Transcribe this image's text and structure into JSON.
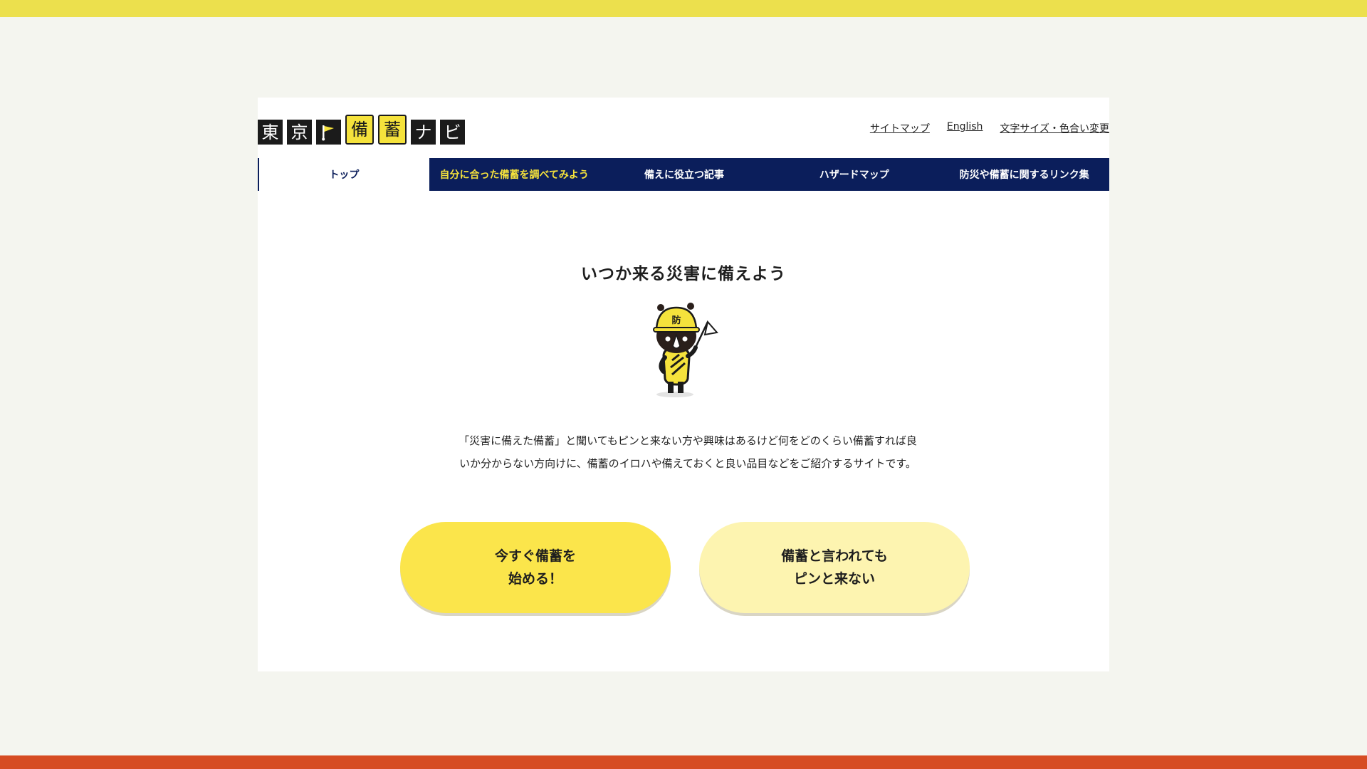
{
  "colors": {
    "top_stripe": "#ece04d",
    "bottom_stripe": "#d64c23",
    "background": "#f4f5ef",
    "nav_background": "#0b1e5b",
    "nav_highlight_text": "#f5e23c",
    "cta_primary": "#fbe54b",
    "cta_secondary": "#fdf4b0"
  },
  "logo": {
    "chars": [
      "東",
      "京",
      "備",
      "蓄",
      "ナ",
      "ビ"
    ],
    "flag_icon": "flag-icon"
  },
  "utility_links": {
    "sitemap": "サイトマップ",
    "english": "English",
    "text_size_color": "文字サイズ・色合い変更"
  },
  "nav": {
    "items": [
      {
        "label": "トップ"
      },
      {
        "label": "自分に合った備蓄を調べてみよう"
      },
      {
        "label": "備えに役立つ記事"
      },
      {
        "label": "ハザードマップ"
      },
      {
        "label": "防災や備蓄に関するリンク集"
      }
    ]
  },
  "main": {
    "headline": "いつか来る災害に備えよう",
    "mascot_helmet_text": "防",
    "intro_line1": "「災害に備えた備蓄」と聞いてもピンと来ない方や興味はあるけど何をどのくらい備蓄すれば良",
    "intro_line2": "いか分からない方向けに、備蓄のイロハや備えておくと良い品目などをご紹介するサイトです。"
  },
  "cta": {
    "primary_label": "今すぐ備蓄を\n始める！",
    "secondary_label": "備蓄と言われても\nピンと来ない"
  }
}
